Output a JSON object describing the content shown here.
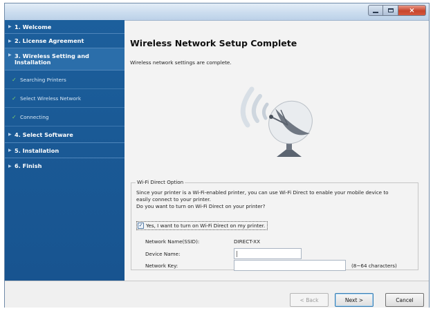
{
  "window": {
    "controls": {
      "minimize": "minimize-icon",
      "maximize": "maximize-icon",
      "close": "×"
    }
  },
  "sidebar": {
    "steps": [
      {
        "label": "1. Welcome"
      },
      {
        "label": "2. License Agreement"
      },
      {
        "label": "3. Wireless Setting and Installation",
        "active": true
      },
      {
        "label": "4. Select Software"
      },
      {
        "label": "5. Installation"
      },
      {
        "label": "6. Finish"
      }
    ],
    "substeps": [
      {
        "label": "Searching Printers"
      },
      {
        "label": "Select Wireless Network"
      },
      {
        "label": "Connecting"
      }
    ],
    "colors": {
      "background": "#1a5a96",
      "check": "#7fd26a"
    }
  },
  "main": {
    "title": "Wireless Network Setup Complete",
    "subtitle": "Wireless network settings are complete.",
    "illustration": "satellite-dish-icon"
  },
  "wifi_direct": {
    "legend": "Wi-Fi Direct Option",
    "description_line1": "Since your printer is a Wi-Fi-enabled printer, you can use Wi-Fi Direct to enable your mobile device to",
    "description_line2": "easily connect to your printer.",
    "description_line3": "Do you want to turn on Wi-Fi Direct on your printer?",
    "checkbox_label": "Yes, I want to turn on Wi-Fi Direct on my printer.",
    "checkbox_checked": true,
    "network_name_label": "Network Name(SSID):",
    "network_name_value": "DIRECT-XX",
    "device_name_label": "Device Name:",
    "device_name_value": "",
    "network_key_label": "Network Key:",
    "network_key_value": "",
    "network_key_hint": "(8~64 characters)"
  },
  "footer": {
    "back_label": "< Back",
    "next_label": "Next >",
    "cancel_label": "Cancel"
  }
}
